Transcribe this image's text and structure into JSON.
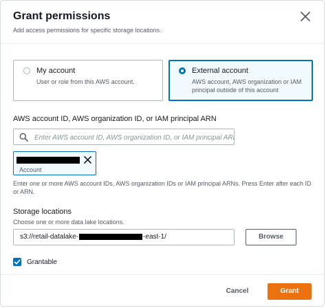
{
  "dialog": {
    "title": "Grant permissions",
    "subtitle": "Add access permissions for specific storage locations."
  },
  "account_type": {
    "options": [
      {
        "label": "My account",
        "description": "User or role from this AWS account.",
        "selected": false
      },
      {
        "label": "External account",
        "description": "AWS account, AWS organization or IAM principal outside of this account",
        "selected": true
      }
    ]
  },
  "principal": {
    "label": "AWS account ID, AWS organization ID, or IAM principal ARN",
    "placeholder": "Enter AWS account ID, AWS organization ID, or IAM principal ARN",
    "value": "",
    "token_label": "Account",
    "help": "Enter one or more AWS account IDs, AWS organization IDs or IAM principal ARNs. Press Enter after each ID or ARN."
  },
  "storage": {
    "label": "Storage locations",
    "description": "Choose one or more data lake locations.",
    "path_prefix": "s3://retail-datalake-",
    "path_suffix": "-east-1/",
    "browse_label": "Browse"
  },
  "grantable": {
    "label": "Grantable",
    "checked": true
  },
  "footer": {
    "cancel_label": "Cancel",
    "grant_label": "Grant"
  },
  "icons": {
    "close": "close-icon",
    "search": "search-icon",
    "remove": "close-icon",
    "check": "check-icon"
  },
  "colors": {
    "primary_blue": "#0073bb",
    "accent_orange": "#ec7211",
    "text_secondary": "#545b64"
  }
}
